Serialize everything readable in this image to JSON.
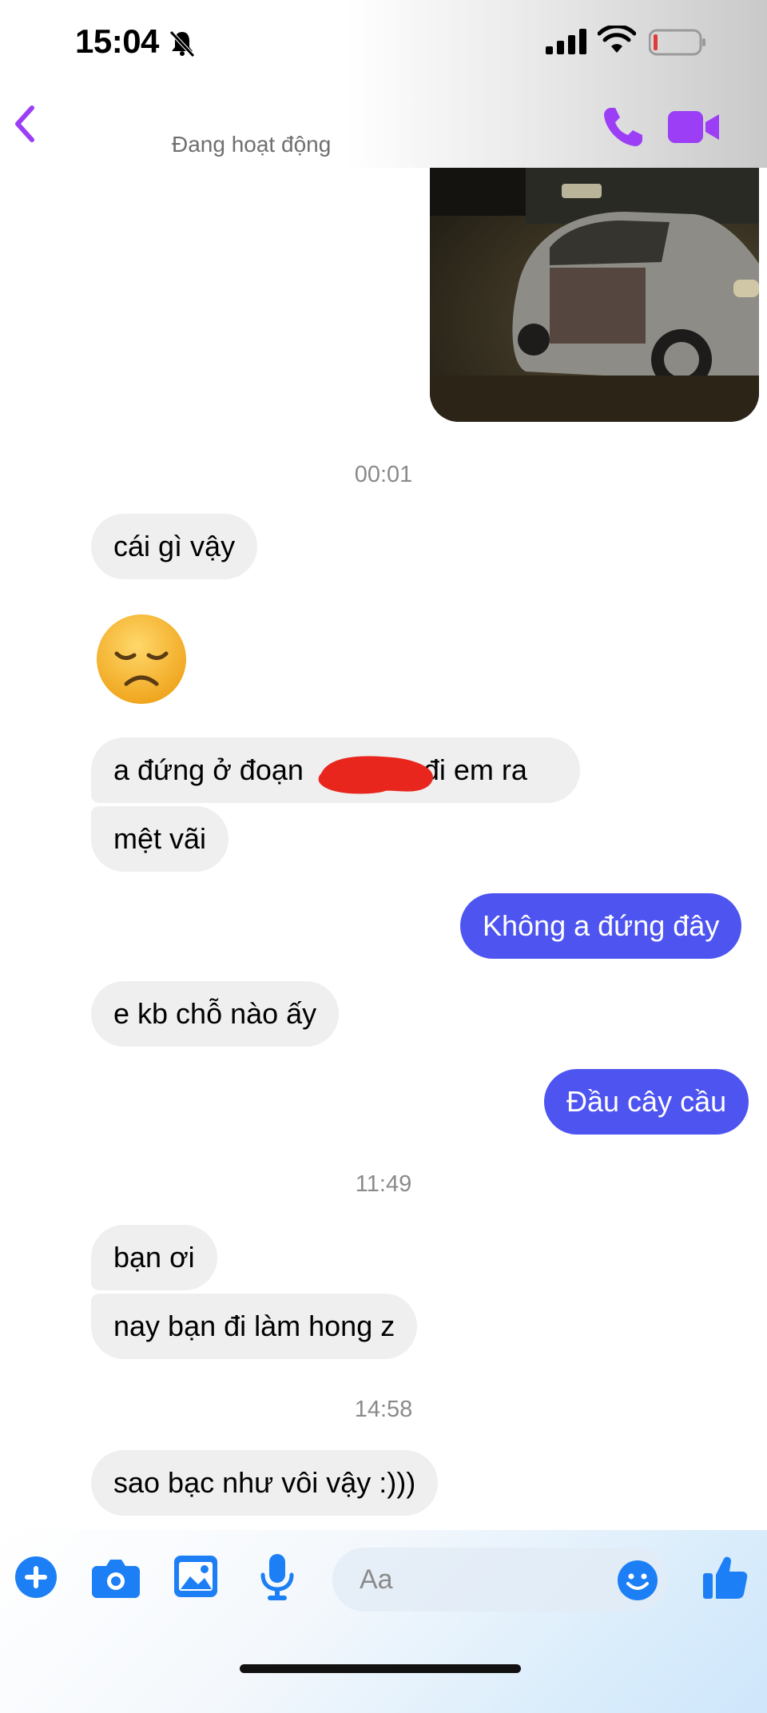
{
  "status_bar": {
    "time": "15:04",
    "battery_color": "#e03b3b"
  },
  "header": {
    "active_status": "Đang hoạt động",
    "accent": "#9b3ef5"
  },
  "messages": {
    "ts1": "00:01",
    "m1": "cái gì vậy",
    "m2_emoji": "disappointed-face-emoji",
    "m3": "a đứng ở đoạn",
    "m3_tail": "đi em ra",
    "m4": "mệt vãi",
    "m5": "Không a đứng đây",
    "m6": "e kb chỗ nào ấy",
    "m7": "Đầu cây cầu",
    "ts2": "11:49",
    "m8": "bạn ơi",
    "m9": "nay bạn đi làm hong z",
    "ts3": "14:58",
    "m10": "sao bạc như vôi vậy :)))"
  },
  "composer": {
    "placeholder": "Aa"
  },
  "colors": {
    "outgoing_bubble": "#4e54f0",
    "incoming_bubble": "#efefef",
    "composer_icons": "#1d7ff5"
  }
}
